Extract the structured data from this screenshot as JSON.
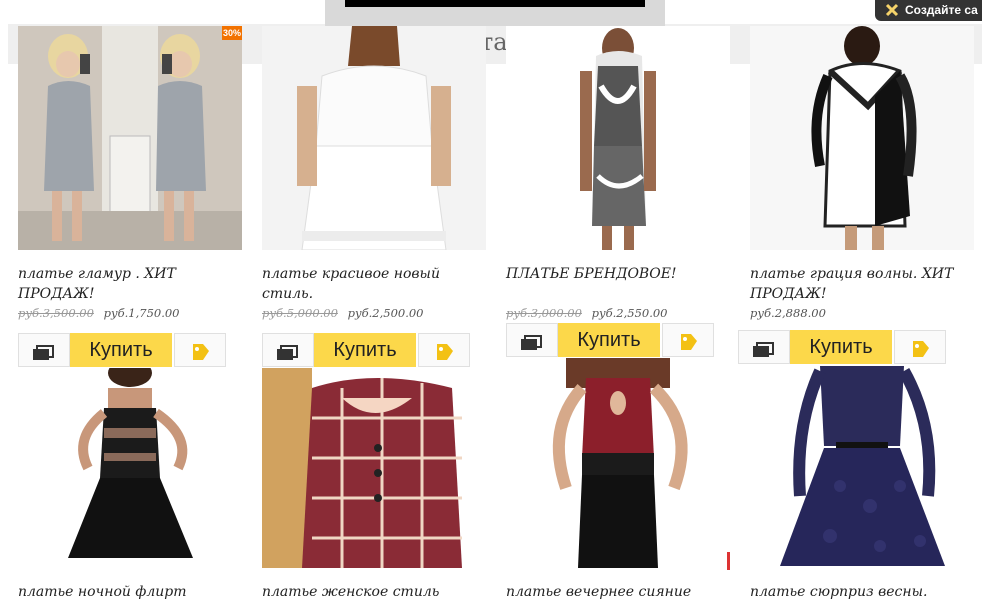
{
  "header": {
    "title_fragment": "та",
    "create_label": "Создайте са"
  },
  "buttons": {
    "buy_label": "Купить"
  },
  "products": [
    {
      "name": "платье гламур . ХИТ ПРОДАЖ!",
      "old_price": "руб.3,500.00",
      "price": "руб.1,750.00",
      "badge": "30%"
    },
    {
      "name": "платье красивое новый стиль.",
      "old_price": "руб.5,000.00",
      "price": "руб.2,500.00"
    },
    {
      "name": "ПЛАТЬЕ БРЕНДОВОЕ!",
      "old_price": "руб.3,000.00",
      "price": "руб.2,550.00"
    },
    {
      "name": "платье грация волны. ХИТ ПРОДАЖ!",
      "price": "руб.2,888.00"
    },
    {
      "name": "платье ночной флирт"
    },
    {
      "name": "платье женское стиль"
    },
    {
      "name": "платье вечернее сияние"
    },
    {
      "name": "платье сюрприз весны."
    }
  ],
  "icons": {
    "compare": "compare-icon",
    "favorite": "favorite-tag-icon",
    "close": "close-icon"
  },
  "colors": {
    "buy_button": "#fcd84a",
    "accent": "#f27200"
  }
}
